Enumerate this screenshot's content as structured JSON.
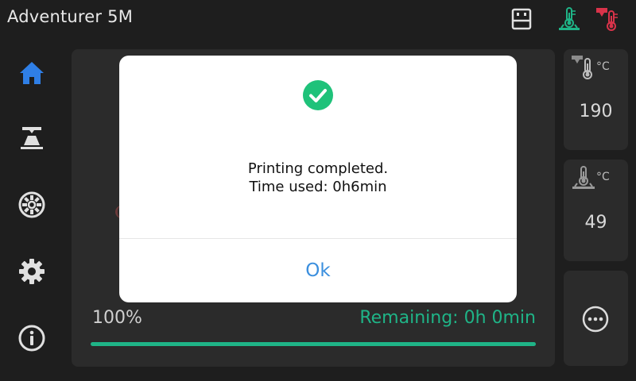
{
  "app": {
    "title": "Adventurer 5M"
  },
  "topbar": {
    "icons": [
      "usb-drive-icon",
      "bed-temperature-icon",
      "nozzle-temperature-icon"
    ],
    "colors": {
      "bed_icon": "#1fb487",
      "nozzle_icon": "#d9334a"
    }
  },
  "sidebar": {
    "items": [
      {
        "name": "home",
        "icon": "home-icon",
        "active": true
      },
      {
        "name": "print",
        "icon": "printer-icon"
      },
      {
        "name": "filament",
        "icon": "filament-spool-icon"
      },
      {
        "name": "settings",
        "icon": "gear-icon"
      },
      {
        "name": "info",
        "icon": "info-icon"
      }
    ],
    "active_color": "#2f7fe6"
  },
  "job": {
    "progress_label": "100%",
    "progress": 1.0,
    "remaining": "Remaining: 0h 0min",
    "accent_color": "#1fb487"
  },
  "status_cards": {
    "nozzle": {
      "icon": "nozzle-thermometer-icon",
      "unit": "°C",
      "value": "190"
    },
    "bed": {
      "icon": "bed-thermometer-icon",
      "unit": "°C",
      "value": "49"
    },
    "more": {
      "icon": "more-options-icon"
    }
  },
  "dialog": {
    "icon": "success-check-icon",
    "line1": "Printing completed.",
    "line2": "Time used: 0h6min",
    "ok_label": "Ok",
    "ok_color": "#3b8fde",
    "icon_color": "#1fc27a"
  }
}
